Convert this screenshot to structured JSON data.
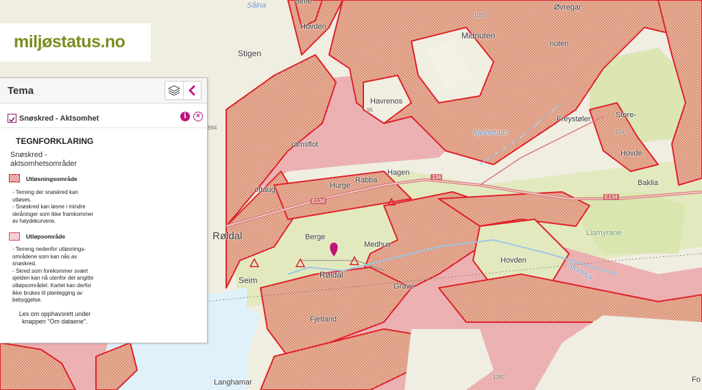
{
  "logo": {
    "text": "miljøstatus.no"
  },
  "panel": {
    "title": "Tema",
    "layer": {
      "name": "Snøskred - Aktsomhet",
      "checked": true
    },
    "legend": {
      "title": "TEGNFORKLARING",
      "subtitle": "Snøskred - aktsomhetsområder",
      "items": [
        {
          "name": "Utløsningsområde",
          "lines": [
            "- Terreng der snøskred kan",
            "utløses.",
            "- Snøskred kan løsne i mindre",
            "skråninger som ikke framkommer",
            "av høydekurvene."
          ]
        },
        {
          "name": "Utløpsområde",
          "lines": [
            "- Terreng nedenfor utløsnings-",
            "områdene som kan nås av",
            "snøskred.",
            "- Skred som forekommer svært",
            "sjelden kan nå utenfor det angitte",
            "utløpsområdet. Kartet kan derfor",
            "ikke brukes til planlegging av",
            "bebyggelse."
          ]
        }
      ],
      "note_lines": [
        "Les om opphavsrett under",
        "knappen \"Om dataene\"."
      ]
    }
  },
  "colors": {
    "release_area": "#d7202a",
    "runout_area": "#e8a0ad",
    "accent": "#c0137b",
    "brand": "#7a8e1f"
  },
  "map": {
    "labels": {
      "stigen": "Stigen",
      "hovden_top": "Hovden",
      "sime": "Sime",
      "midnuten": "Midnuten",
      "h1055": "1055",
      "ovregar": "Øvregar",
      "nuten": "nuten",
      "havrenos": "Havrenos",
      "h96": "96",
      "freysteler": "Freystøler",
      "store": "Store-",
      "h834": "834",
      "h894": "894",
      "ramsflot": "ramsflot",
      "hagen": "Hagen",
      "rabba": "Rabba",
      "hurge": "Hurge",
      "road134a": "E134",
      "road134b": "E134",
      "road134c": "134",
      "baklia": "Baklia",
      "hovde_right": "Hovde",
      "loftaug": "oftaug",
      "roldal_w": "Røldal",
      "berge": "Berge",
      "medhus": "Medhus",
      "roldal": "Røldal",
      "liamyrane": "Liamyrane",
      "hovden_mid": "Hovden",
      "storelva": "Storelva",
      "seim": "Seim",
      "grave": "Grave",
      "fjetland": "Fjetland",
      "langhamar": "Langhamar",
      "h1287": "1287",
      "fo": "Fo",
      "salna": "Sålna",
      "kjeldehum": "Kjeldehum"
    }
  }
}
